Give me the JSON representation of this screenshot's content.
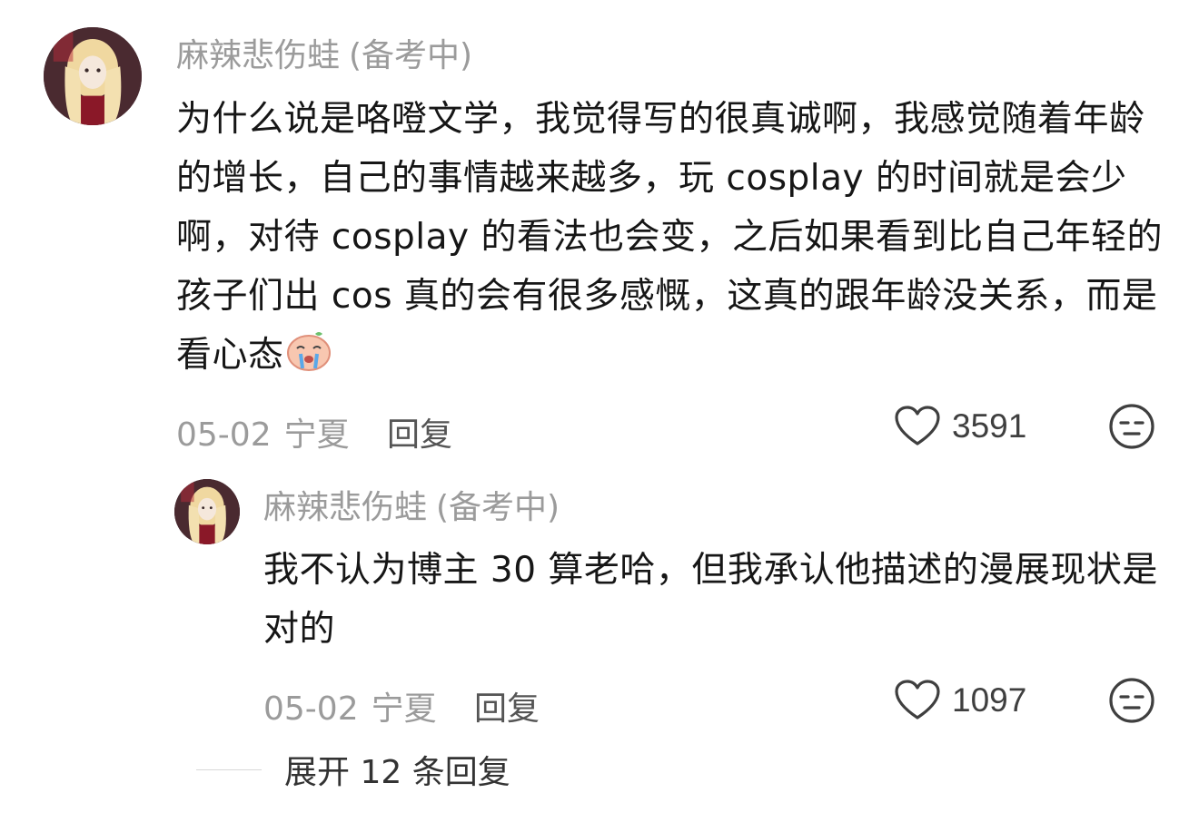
{
  "comments": {
    "main": {
      "author": "麻辣悲伤蛙",
      "author_suffix": "(备考中)",
      "text": "为什么说是咯噔文学，我觉得写的很真诚啊，我感觉随着年龄的增长，自己的事情越来越多，玩 cosplay 的时间就是会少啊，对待 cosplay 的看法也会变，之后如果看到比自己年轻的孩子们出 cos 真的会有很多感慨，这真的跟年龄没关系，而是看心态",
      "date": "05-02",
      "location": "宁夏",
      "reply_label": "回复",
      "likes": "3591",
      "emoji": "crying-face-emoji"
    },
    "reply": {
      "author": "麻辣悲伤蛙",
      "author_suffix": "(备考中)",
      "text": "我不认为博主 30 算老哈，但我承认他描述的漫展现状是对的",
      "date": "05-02",
      "location": "宁夏",
      "reply_label": "回复",
      "likes": "1097"
    }
  },
  "expand": {
    "label": "展开 12 条回复"
  },
  "icons": {
    "like": "heart-icon",
    "dislike": "unamused-face-icon"
  },
  "colors": {
    "text": "#161616",
    "meta": "#9b9b9b",
    "reply_button": "#555555",
    "icon": "#3f3f3f"
  }
}
